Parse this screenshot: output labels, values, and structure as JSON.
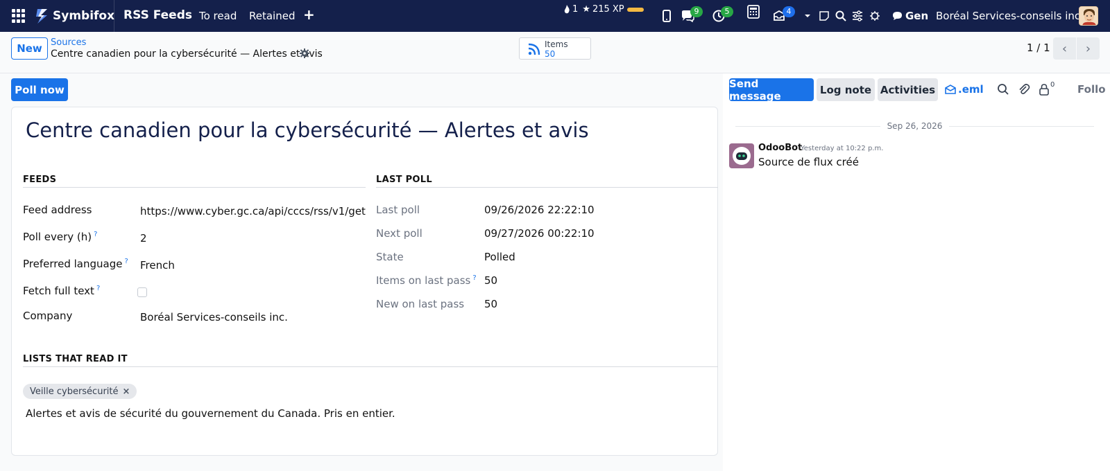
{
  "navbar": {
    "brand": "Symbifox",
    "app_title": "RSS Feeds",
    "menu": [
      "To read",
      "Retained"
    ],
    "streak": "1",
    "xp": "215 XP",
    "badges": {
      "chat": "9",
      "activity": "5",
      "mail": "4"
    },
    "gen_label": "Gen",
    "company": "Boréal Services-conseils inc."
  },
  "control": {
    "new_label": "New",
    "breadcrumb_parent": "Sources",
    "breadcrumb_current": "Centre canadien pour la cybersécurité — Alertes et avis",
    "stat_label": "Items",
    "stat_value": "50",
    "pager": "1 / 1"
  },
  "actions": {
    "poll_now": "Poll now"
  },
  "form": {
    "title": "Centre canadien pour la cybersécurité — Alertes et avis",
    "feeds_section": "FEEDS",
    "last_poll_section": "LAST POLL",
    "lists_section": "LISTS THAT READ IT",
    "feed_address_label": "Feed address",
    "feed_address_value": "https://www.cyber.gc.ca/api/cccs/rss/v1/get",
    "poll_every_label": "Poll every (h)",
    "poll_every_value": "2",
    "language_label": "Preferred language",
    "language_value": "French",
    "fetch_label": "Fetch full text",
    "fetch_checked": false,
    "company_label": "Company",
    "company_value": "Boréal Services-conseils inc.",
    "last_poll_label": "Last poll",
    "last_poll_value": "09/26/2026 22:22:10",
    "next_poll_label": "Next poll",
    "next_poll_value": "09/27/2026 00:22:10",
    "state_label": "State",
    "state_value": "Polled",
    "items_last_label": "Items on last pass",
    "items_last_value": "50",
    "new_last_label": "New on last pass",
    "new_last_value": "50",
    "help_mark": "?",
    "tag": "Veille cybersécurité",
    "tag_remove": "×",
    "note": "Alertes et avis de sécurité du gouvernement du Canada. Pris en entier."
  },
  "chatter": {
    "send_message": "Send message",
    "log_note": "Log note",
    "activities": "Activities",
    "eml": ".eml",
    "followers_count": "0",
    "follow": "Follo",
    "date_separator": "Sep 26, 2026",
    "author": "OdooBot",
    "msg_date": "Yesterday at 10:22 p.m.",
    "msg_body": "Source de flux créé"
  },
  "colors": {
    "navbar": "#14204b",
    "primary": "#1a73e8",
    "badge_green": "#28a745",
    "badge_blue": "#1f6feb",
    "xp_bar": "#f4b942"
  }
}
